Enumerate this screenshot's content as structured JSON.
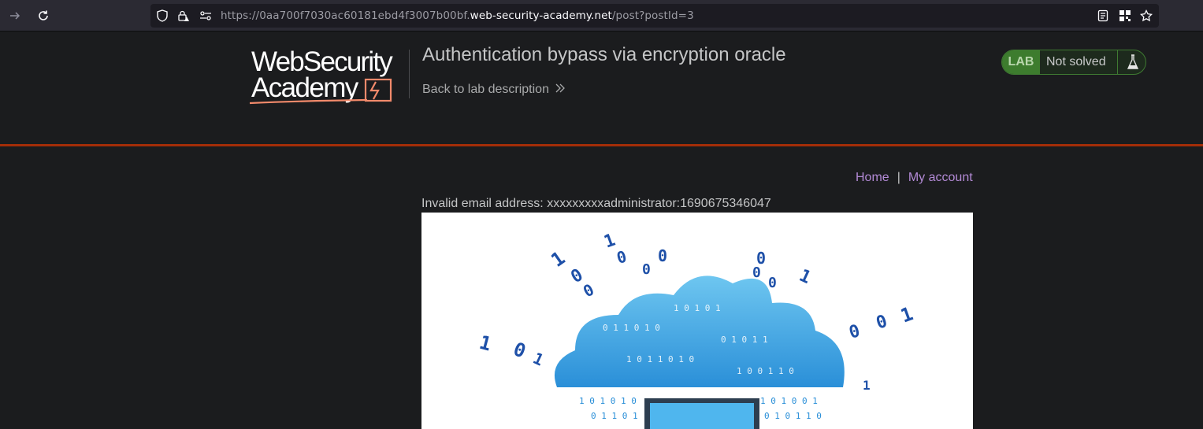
{
  "browser": {
    "url_prefix": "https://0aa700f7030ac60181ebd4f3007b00bf.",
    "url_host": "web-security-academy.net",
    "url_path": "/post?postId=3"
  },
  "header": {
    "logo_line1": "WebSecurity",
    "logo_line2": "Academy",
    "lab_title": "Authentication bypass via encryption oracle",
    "back_link": "Back to lab description",
    "lab_badge": "LAB",
    "lab_status": "Not solved"
  },
  "nav": {
    "home": "Home",
    "separator": "|",
    "my_account": "My account"
  },
  "main": {
    "notification": "Invalid email address: xxxxxxxxxadministrator:1690675346047"
  },
  "colors": {
    "accent_orange": "#a42d08",
    "link_purple": "#b38ad6",
    "lab_green": "#3d7c2e"
  }
}
